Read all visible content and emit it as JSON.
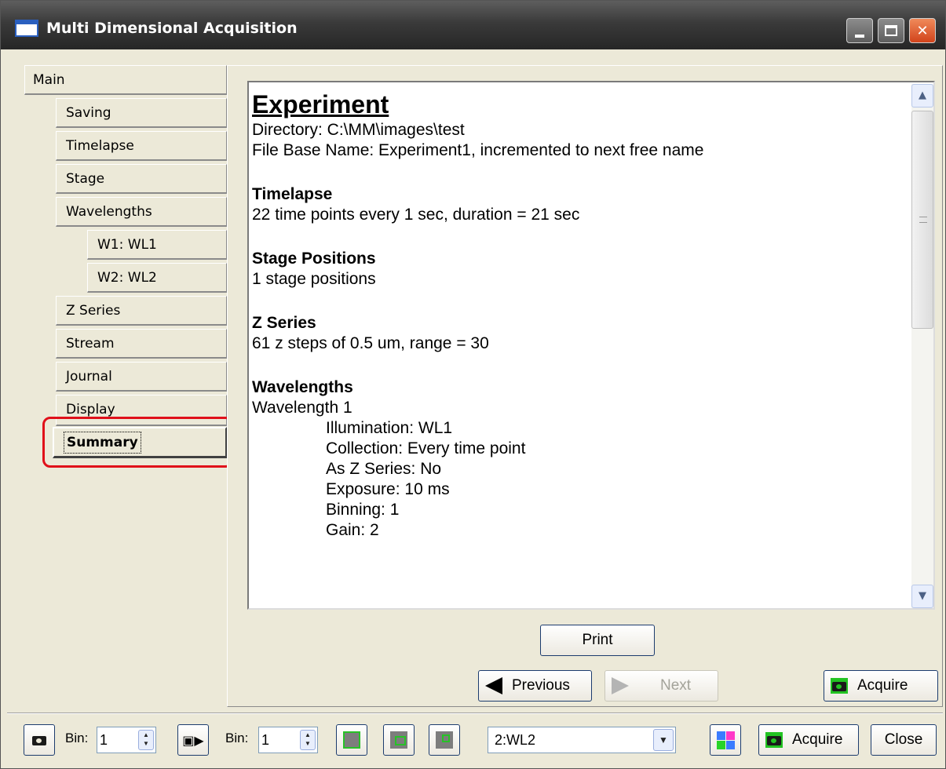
{
  "window": {
    "title": "Multi Dimensional Acquisition"
  },
  "nav": {
    "main": "Main",
    "items": [
      {
        "label": "Saving",
        "level": 1
      },
      {
        "label": "Timelapse",
        "level": 1
      },
      {
        "label": "Stage",
        "level": 1
      },
      {
        "label": "Wavelengths",
        "level": 1
      },
      {
        "label": "W1: WL1",
        "level": 2
      },
      {
        "label": "W2: WL2",
        "level": 2
      },
      {
        "label": "Z Series",
        "level": 1
      },
      {
        "label": "Stream",
        "level": 1
      },
      {
        "label": "Journal",
        "level": 1
      },
      {
        "label": "Display",
        "level": 1
      }
    ],
    "selected": "Summary"
  },
  "summary": {
    "experiment_heading": "Experiment",
    "directory": "Directory: C:\\MM\\images\\test",
    "file_base": "File Base Name: Experiment1, incremented to next free name",
    "timelapse_heading": "Timelapse",
    "timelapse_text": "22 time points every 1 sec, duration = 21 sec",
    "stage_heading": "Stage Positions",
    "stage_text": "1 stage positions",
    "z_heading": "Z Series",
    "z_text": "61 z steps of 0.5 um,  range = 30",
    "wl_heading": "Wavelengths",
    "wl1_label": "Wavelength 1",
    "wl1_illumination": "Illumination: WL1",
    "wl1_collection": "Collection: Every time point",
    "wl1_asz": "As Z Series: No",
    "wl1_exposure": "Exposure: 10 ms",
    "wl1_binning": "Binning: 1",
    "wl1_next": "Gain: 2"
  },
  "buttons": {
    "print": "Print",
    "previous": "Previous",
    "next": "Next",
    "acquire": "Acquire",
    "acquire2": "Acquire",
    "close": "Close"
  },
  "toolbar": {
    "bin_label": "Bin:",
    "bin1_value": "1",
    "bin2_value": "1",
    "wavelength_selected": "2:WL2"
  },
  "colors": {
    "accent_green": "#27c227",
    "highlight_red": "#e0101a"
  }
}
